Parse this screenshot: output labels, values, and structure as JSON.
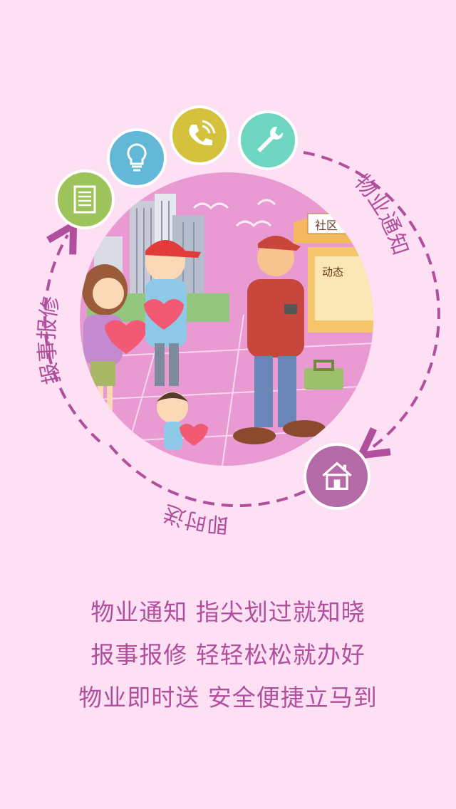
{
  "colors": {
    "background": "#fde0f3",
    "accent": "#b14f9d",
    "badge_document": "#9cc45a",
    "badge_bulb": "#63b8d8",
    "badge_phone": "#d4c23c",
    "badge_wrench": "#6ed5c0",
    "badge_home": "#b56aa8"
  },
  "ring": {
    "label_notice": "物业通知",
    "label_repair": "报事报修",
    "label_delivery": "即时送"
  },
  "icons": {
    "document": "document-icon",
    "bulb": "lightbulb-icon",
    "phone": "phone-icon",
    "wrench": "wrench-icon",
    "home": "home-icon"
  },
  "illustration": {
    "sign_text": "社区",
    "board_text": "动态"
  },
  "taglines": [
    "物业通知 指尖划过就知晓",
    "报事报修 轻轻松松就办好",
    "物业即时送 安全便捷立马到"
  ]
}
